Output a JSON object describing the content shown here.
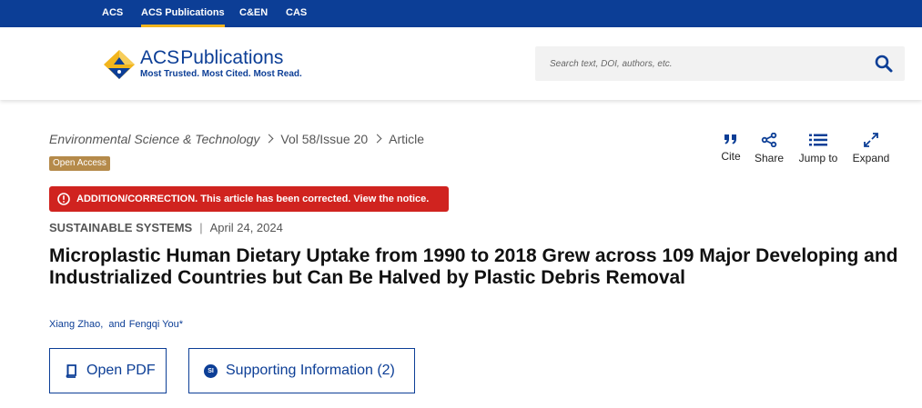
{
  "network": {
    "links": [
      {
        "label": "ACS",
        "active": false
      },
      {
        "label": "ACS Publications",
        "active": true
      },
      {
        "label": "C&EN",
        "active": false
      },
      {
        "label": "CAS",
        "active": false
      }
    ]
  },
  "header": {
    "logo_name_prefix": "ACS",
    "logo_name_suffix": "Publications",
    "logo_tagline": "Most Trusted. Most Cited. Most Read.",
    "search_placeholder": "Search text, DOI, authors, etc."
  },
  "breadcrumb": {
    "journal": "Environmental Science & Technology",
    "issue": "Vol 58/Issue 20",
    "type": "Article"
  },
  "badge": {
    "open_access": "Open Access"
  },
  "tools": [
    {
      "label": "Cite",
      "icon": "quote-icon"
    },
    {
      "label": "Share",
      "icon": "share-icon"
    },
    {
      "label": "Jump to",
      "icon": "list-icon"
    },
    {
      "label": "Expand",
      "icon": "expand-icon"
    }
  ],
  "correction": {
    "text": "ADDITION/CORRECTION. This article has been corrected. View the notice."
  },
  "article": {
    "section": "SUSTAINABLE SYSTEMS",
    "date": "April 24, 2024",
    "title": "Microplastic Human Dietary Uptake from 1990 to 2018 Grew across 109 Major Developing and Industrialized Countries but Can Be Halved by Plastic Debris Removal",
    "authors": [
      "Xiang Zhao,",
      "Fengqi You*"
    ],
    "authors_joiner": "and"
  },
  "buttons": {
    "open_pdf": "Open PDF",
    "si_badge": "SI",
    "supporting_info": "Supporting Information (2)"
  },
  "colors": {
    "brand_blue": "#0c3e96",
    "accent_gold": "#f2b51d",
    "alert_red": "#d0231f",
    "open_access_tan": "#b58a4a"
  }
}
